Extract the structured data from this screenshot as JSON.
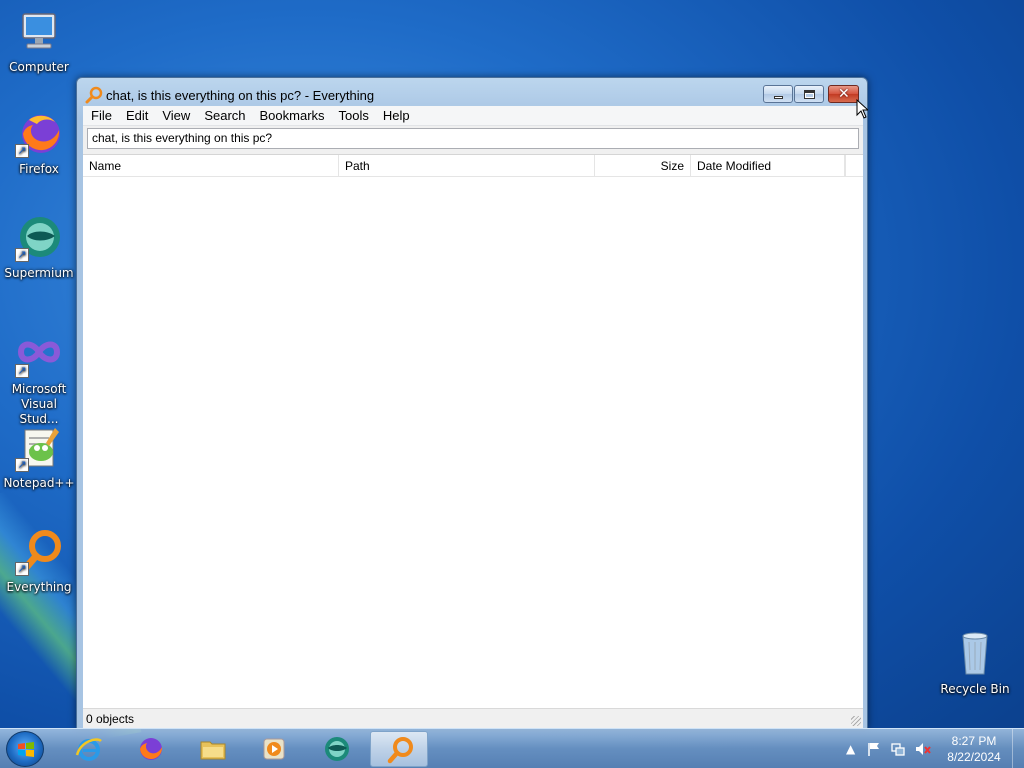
{
  "desktop": {
    "icons": [
      {
        "label": "Computer",
        "icon": "computer-icon"
      },
      {
        "label": "Firefox",
        "icon": "firefox-icon"
      },
      {
        "label": "Supermium",
        "icon": "supermium-icon"
      },
      {
        "label": "Microsoft Visual Stud...",
        "icon": "visual-studio-icon"
      },
      {
        "label": "Notepad++",
        "icon": "notepadpp-icon"
      },
      {
        "label": "Everything",
        "icon": "everything-icon"
      },
      {
        "label": "Recycle Bin",
        "icon": "recycle-bin-icon"
      }
    ]
  },
  "window": {
    "title": "chat, is this everything on this pc? - Everything",
    "menu": [
      "File",
      "Edit",
      "View",
      "Search",
      "Bookmarks",
      "Tools",
      "Help"
    ],
    "search_value": "chat, is this everything on this pc?",
    "columns": {
      "name": "Name",
      "path": "Path",
      "size": "Size",
      "date": "Date Modified"
    },
    "status": "0 objects"
  },
  "taskbar": {
    "pinned": [
      "internet-explorer-icon",
      "firefox-icon",
      "explorer-folder-icon",
      "media-player-icon",
      "supermium-icon",
      "everything-icon"
    ],
    "active": "everything-icon"
  },
  "tray": {
    "time": "8:27 PM",
    "date": "8/22/2024"
  },
  "colors": {
    "desktop_bg": "#1f6cc8",
    "close_button": "#c23b23",
    "everything_orange": "#f08a1c"
  }
}
